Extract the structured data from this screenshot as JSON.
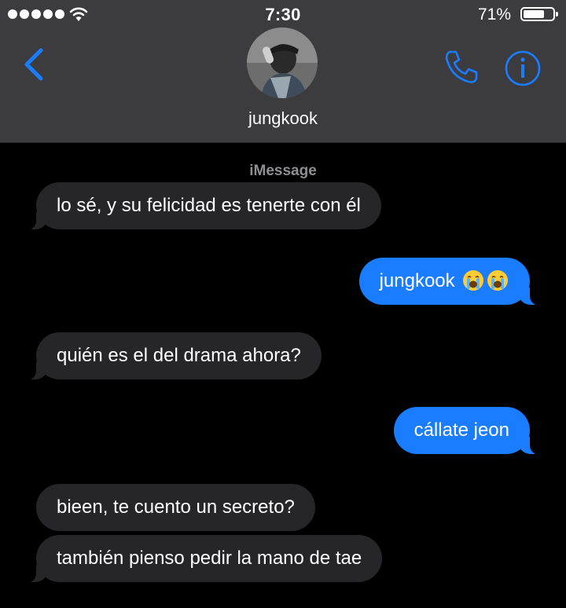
{
  "status_bar": {
    "time": "7:30",
    "battery_percent": "71%",
    "battery_level": 0.71,
    "signal_bars": 5
  },
  "header": {
    "contact_name": "jungkook",
    "back_icon": "chevron-left-icon",
    "call_icon": "phone-icon",
    "info_icon": "info-icon",
    "accent_color": "#1a7cff"
  },
  "conversation": {
    "service_label": "iMessage",
    "messages": [
      {
        "direction": "incoming",
        "text": "lo sé, y su felicidad es tenerte con él"
      },
      {
        "direction": "outgoing",
        "text": "jungkook",
        "emoji": [
          "loudly-crying-face",
          "loudly-crying-face"
        ]
      },
      {
        "direction": "incoming",
        "text": "quién es el del drama ahora?"
      },
      {
        "direction": "outgoing",
        "text": "cállate jeon"
      },
      {
        "direction": "incoming",
        "text": "bieen, te cuento un secreto?"
      },
      {
        "direction": "incoming",
        "text": "también pienso pedir la mano de tae"
      }
    ]
  },
  "colors": {
    "header_bg": "#3c3c3e",
    "incoming_bubble": "#262628",
    "outgoing_bubble": "#1a7cff",
    "background": "#000000"
  }
}
